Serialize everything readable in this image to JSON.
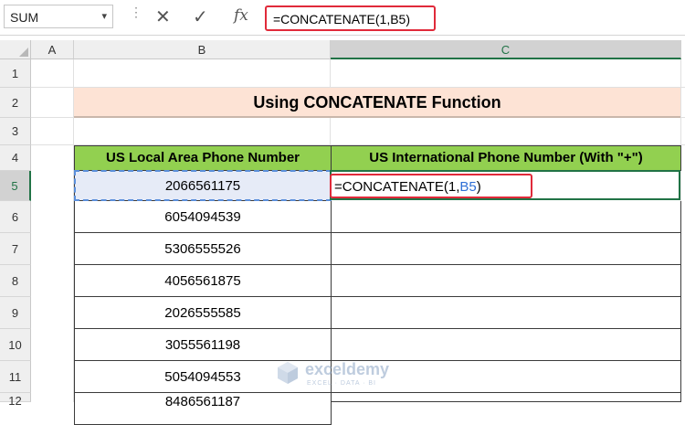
{
  "formula_bar": {
    "name_box": "SUM",
    "name_box_arrow": "▾",
    "more": "⋮",
    "cancel_icon": "✕",
    "enter_icon": "✓",
    "fx_label": "fx",
    "formula": "=CONCATENATE(1,B5)"
  },
  "columns": [
    "A",
    "B",
    "C"
  ],
  "selected_column": "C",
  "rows": [
    "1",
    "2",
    "3",
    "4",
    "5",
    "6",
    "7",
    "8",
    "9",
    "10",
    "11",
    "12"
  ],
  "selected_row": "5",
  "sheet": {
    "title": "Using CONCATENATE Function",
    "headers": {
      "b": "US Local Area Phone Number",
      "c": "US International Phone Number (With \"+\")"
    },
    "phone_numbers": [
      "2066561175",
      "6054094539",
      "5306555526",
      "4056561875",
      "2026555585",
      "3055561198",
      "5054094553",
      "8486561187"
    ],
    "editing_cell": {
      "prefix": "=CONCATENATE(1,",
      "ref": "B5",
      "suffix": ")"
    }
  },
  "colors": {
    "header_fill": "#92d050",
    "title_fill": "#fde3d5",
    "selection": "#217346",
    "highlight_border": "#e02a3a",
    "ref_color": "#2f6fd6"
  },
  "watermark": {
    "name": "exceldemy",
    "tagline": "EXCEL · DATA · BI"
  }
}
